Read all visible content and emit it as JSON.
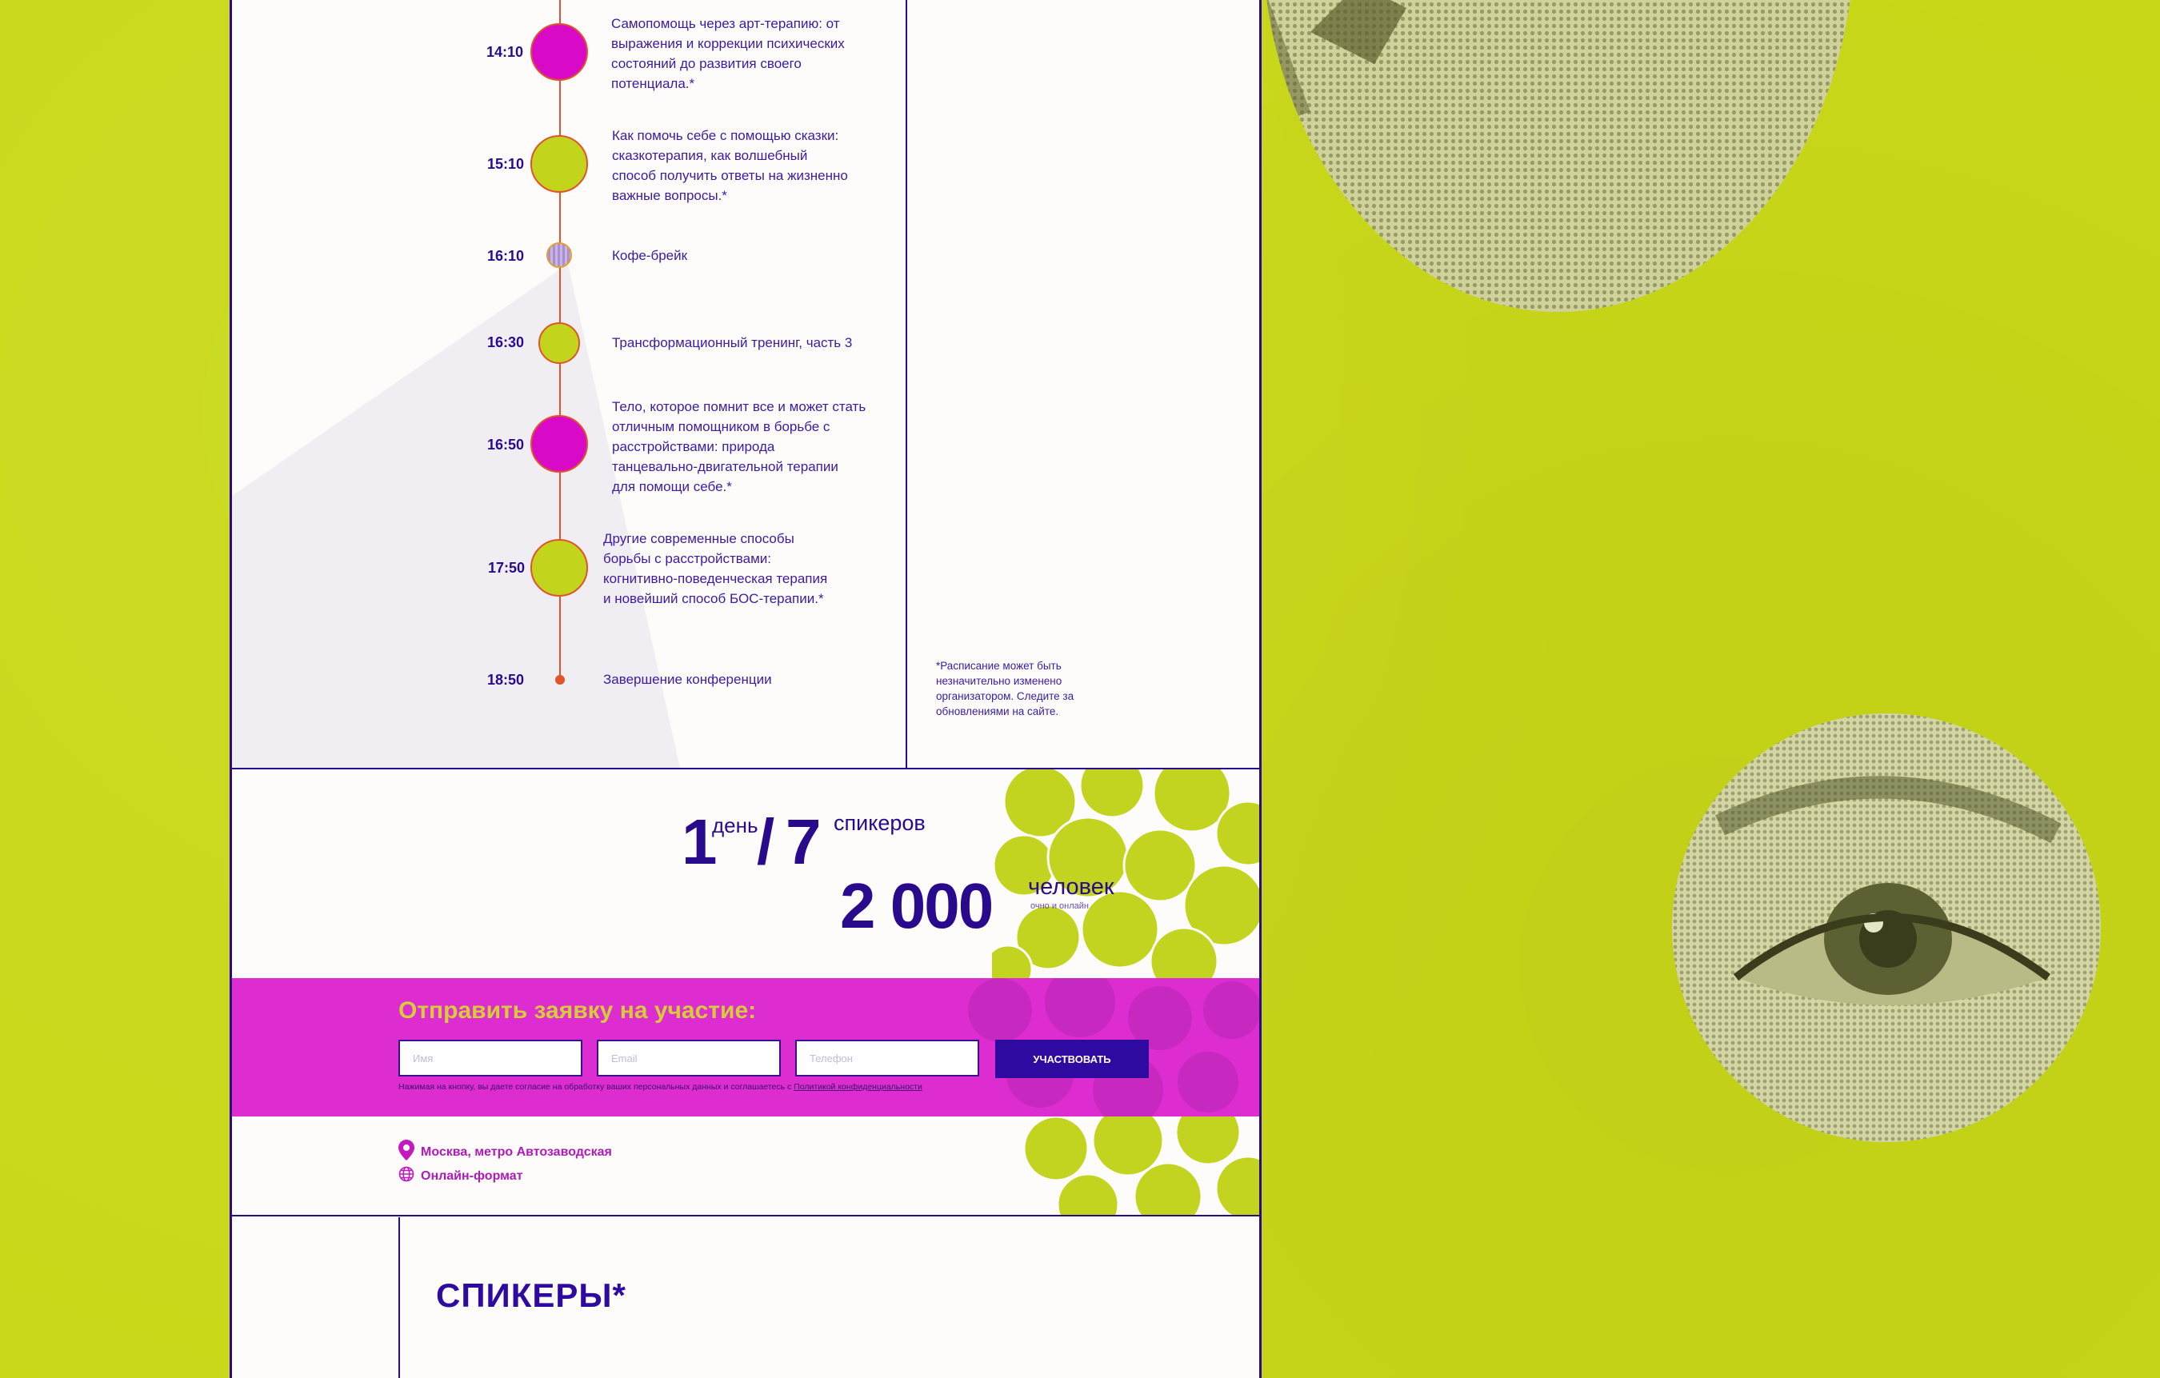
{
  "schedule": {
    "items": [
      {
        "time": "14:10",
        "lines": [
          "Самопомощь через арт-терапию: от",
          "выражения и коррекции психических",
          "состояний до развития своего",
          "потенциала.*"
        ]
      },
      {
        "time": "15:10",
        "lines": [
          "Как помочь себе с помощью сказки:",
          "сказкотерапия, как волшебный",
          "способ получить ответы на жизненно",
          "важные вопросы.*"
        ]
      },
      {
        "time": "16:10",
        "lines": [
          "Кофе-брейк"
        ]
      },
      {
        "time": "16:30",
        "lines": [
          "Трансформационный тренинг, часть 3"
        ]
      },
      {
        "time": "16:50",
        "lines": [
          "Тело, которое помнит все и может стать",
          "отличным помощником в борьбе с",
          "расстройствами: природа",
          "танцевально-двигательной терапии",
          "для помощи себе.*"
        ]
      },
      {
        "time": "17:50",
        "lines": [
          "Другие современные способы",
          "борьбы с расстройствами:",
          "когнитивно-поведенческая терапия",
          "и новейший способ БОС-терапии.*"
        ]
      },
      {
        "time": "18:50",
        "lines": [
          "Завершение конференции"
        ]
      }
    ],
    "note": "*Расписание может быть незначительно изменено организатором. Следите за обновлениями на сайте."
  },
  "stats": {
    "days_num": "1",
    "days_label": "день",
    "slash": "/",
    "speakers_num": "7",
    "speakers_label": "спикеров",
    "people_num": "2 000",
    "people_label": "человек",
    "people_sub": "очно и онлайн"
  },
  "form": {
    "title": "Отправить заявку на участие:",
    "name_placeholder": "Имя",
    "email_placeholder": "Email",
    "phone_placeholder": "Телефон",
    "submit_label": "УЧАСТВОВАТЬ",
    "consent_text": "Нажимая на кнопку, вы даете согласие на обработку ваших персональных данных и соглашаетесь с ",
    "consent_link": "Политикой конфиденциальности"
  },
  "location": {
    "address": "Москва, метро Автозаводская",
    "online": "Онлайн-формат"
  },
  "speakers": {
    "title": "СПИКЕРЫ*"
  },
  "colors": {
    "background_lime": "#c9d818",
    "brand_violet": "#2a0a8c",
    "magenta": "#dd2cd0",
    "accent_orange": "#e0542a"
  },
  "icons": {
    "location": "map-pin-icon",
    "online": "globe-icon"
  }
}
